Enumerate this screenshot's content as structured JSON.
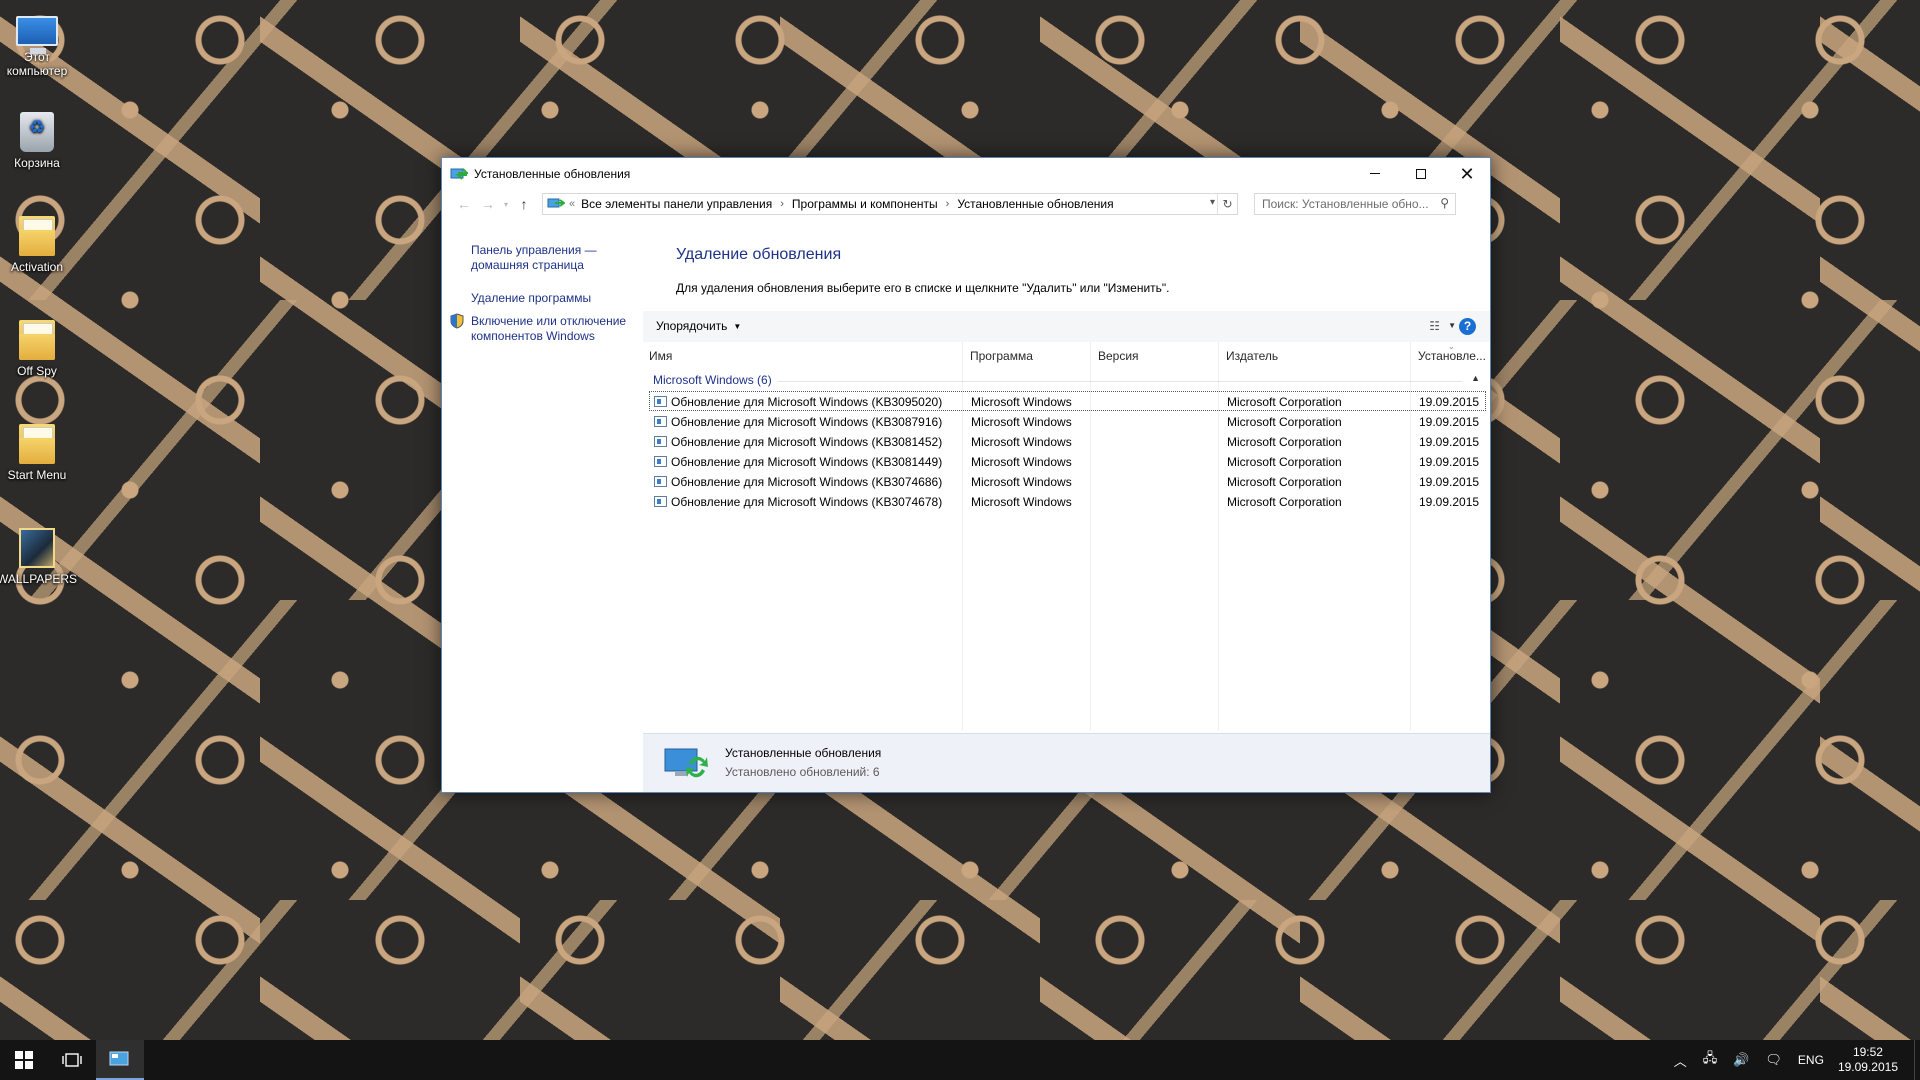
{
  "desktop": {
    "icons": [
      {
        "label": "Этот компьютер"
      },
      {
        "label": "Корзина"
      },
      {
        "label": "Activation"
      },
      {
        "label": "Off Spy"
      },
      {
        "label": "Start Menu"
      },
      {
        "label": "WALLPAPERS"
      }
    ]
  },
  "window": {
    "title": "Установленные обновления",
    "nav": {
      "address_overflow": "«",
      "breadcrumbs": [
        "Все элементы панели управления",
        "Программы и компоненты",
        "Установленные обновления"
      ],
      "search_placeholder": "Поиск: Установленные обно..."
    },
    "left_pane": {
      "home_link": "Панель управления — домашняя страница",
      "uninstall_link": "Удаление программы",
      "features_link": "Включение или отключение компонентов Windows"
    },
    "content": {
      "heading": "Удаление обновления",
      "description": "Для удаления обновления выберите его в списке и щелкните \"Удалить\" или \"Изменить\".",
      "toolbar": {
        "sort_label": "Упорядочить"
      },
      "columns": [
        "Имя",
        "Программа",
        "Версия",
        "Издатель",
        "Установле..."
      ],
      "group": "Microsoft Windows (6)",
      "rows": [
        {
          "name": "Обновление для Microsoft Windows (KB3095020)",
          "program": "Microsoft Windows",
          "version": "",
          "publisher": "Microsoft Corporation",
          "installed": "19.09.2015"
        },
        {
          "name": "Обновление для Microsoft Windows (KB3087916)",
          "program": "Microsoft Windows",
          "version": "",
          "publisher": "Microsoft Corporation",
          "installed": "19.09.2015"
        },
        {
          "name": "Обновление для Microsoft Windows (KB3081452)",
          "program": "Microsoft Windows",
          "version": "",
          "publisher": "Microsoft Corporation",
          "installed": "19.09.2015"
        },
        {
          "name": "Обновление для Microsoft Windows (KB3081449)",
          "program": "Microsoft Windows",
          "version": "",
          "publisher": "Microsoft Corporation",
          "installed": "19.09.2015"
        },
        {
          "name": "Обновление для Microsoft Windows (KB3074686)",
          "program": "Microsoft Windows",
          "version": "",
          "publisher": "Microsoft Corporation",
          "installed": "19.09.2015"
        },
        {
          "name": "Обновление для Microsoft Windows (KB3074678)",
          "program": "Microsoft Windows",
          "version": "",
          "publisher": "Microsoft Corporation",
          "installed": "19.09.2015"
        }
      ]
    },
    "details": {
      "title": "Установленные обновления",
      "count": "Установлено обновлений: 6"
    }
  },
  "taskbar": {
    "language": "ENG",
    "time": "19:52",
    "date": "19.09.2015"
  },
  "colors": {
    "link_blue": "#1e3287",
    "accent": "#1a6fd4",
    "desktop_bg": "#2d2b29",
    "pattern": "#c9a67f"
  }
}
